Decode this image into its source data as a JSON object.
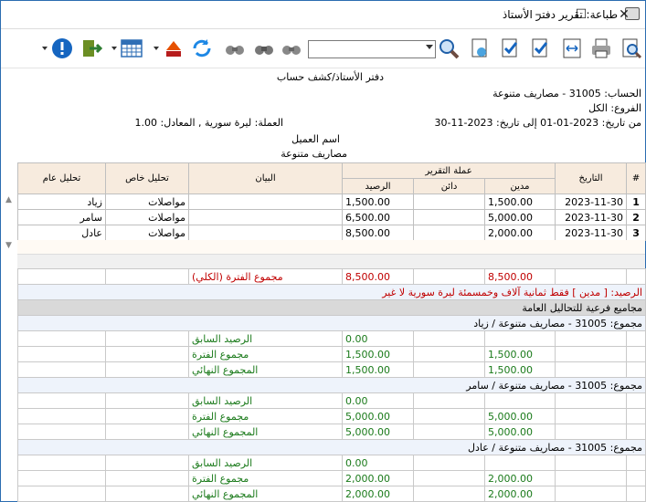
{
  "window": {
    "title": "طباعة: تقرير دفتر الأستاذ",
    "minimize": "–",
    "maximize": "☐",
    "close": "✕"
  },
  "toolbar": {
    "search_value": ""
  },
  "report": {
    "title": "دفتر الأستاذ/كشف حساب",
    "account": "الحساب: 31005 - مصاريف متنوعة",
    "branches": "الفروع: الكل",
    "date_range": "من تاريخ: 2023-01-01   إلى تاريخ: 2023-11-30",
    "currency": "العملة: ليرة سورية , المعادل: 1.00",
    "customer_name": "اسم العميل",
    "account_name": "مصاريف متنوعة"
  },
  "grid": {
    "headers": {
      "num": "#",
      "date": "التاريخ",
      "report_currency": "عملة التقرير",
      "debit": "مدين",
      "credit": "دائن",
      "balance": "الرصيد",
      "statement": "البيان",
      "private_analysis": "تحليل خاص",
      "general_analysis": "تحليل عام"
    },
    "rows": [
      {
        "num": "1",
        "date": "2023-11-30",
        "debit": "1,500.00",
        "credit": "",
        "balance": "1,500.00",
        "statement": "",
        "private": "مواصلات",
        "general": "زياد"
      },
      {
        "num": "2",
        "date": "2023-11-30",
        "debit": "5,000.00",
        "credit": "",
        "balance": "6,500.00",
        "statement": "",
        "private": "مواصلات",
        "general": "سامر"
      },
      {
        "num": "3",
        "date": "2023-11-30",
        "debit": "2,000.00",
        "credit": "",
        "balance": "8,500.00",
        "statement": "",
        "private": "مواصلات",
        "general": "عادل"
      }
    ]
  },
  "summary": {
    "total_debit": "8,500.00",
    "total_balance": "8,500.00",
    "period_total_label": "مجموع الفترة (الكلي)",
    "balance_text": "الرصيد: [ مدين ] فقط ثمانية آلاف وخمسمئة ليرة سورية لا غير",
    "section_title": "مجاميع فرعية للتحاليل العامة",
    "groups": [
      {
        "title": "مجموع: 31005 - مصاريف متنوعة / زياد",
        "lines": [
          {
            "label": "الرصيد السابق",
            "balance": "0.00",
            "debit": ""
          },
          {
            "label": "مجموع الفترة",
            "balance": "1,500.00",
            "debit": "1,500.00"
          },
          {
            "label": "المجموع النهائي",
            "balance": "1,500.00",
            "debit": "1,500.00"
          }
        ]
      },
      {
        "title": "مجموع: 31005 - مصاريف متنوعة / سامر",
        "lines": [
          {
            "label": "الرصيد السابق",
            "balance": "0.00",
            "debit": ""
          },
          {
            "label": "مجموع الفترة",
            "balance": "5,000.00",
            "debit": "5,000.00"
          },
          {
            "label": "المجموع النهائي",
            "balance": "5,000.00",
            "debit": "5,000.00"
          }
        ]
      },
      {
        "title": "مجموع: 31005 - مصاريف متنوعة / عادل",
        "lines": [
          {
            "label": "الرصيد السابق",
            "balance": "0.00",
            "debit": ""
          },
          {
            "label": "مجموع الفترة",
            "balance": "2,000.00",
            "debit": "2,000.00"
          },
          {
            "label": "المجموع النهائي",
            "balance": "2,000.00",
            "debit": "2,000.00"
          }
        ]
      }
    ]
  }
}
